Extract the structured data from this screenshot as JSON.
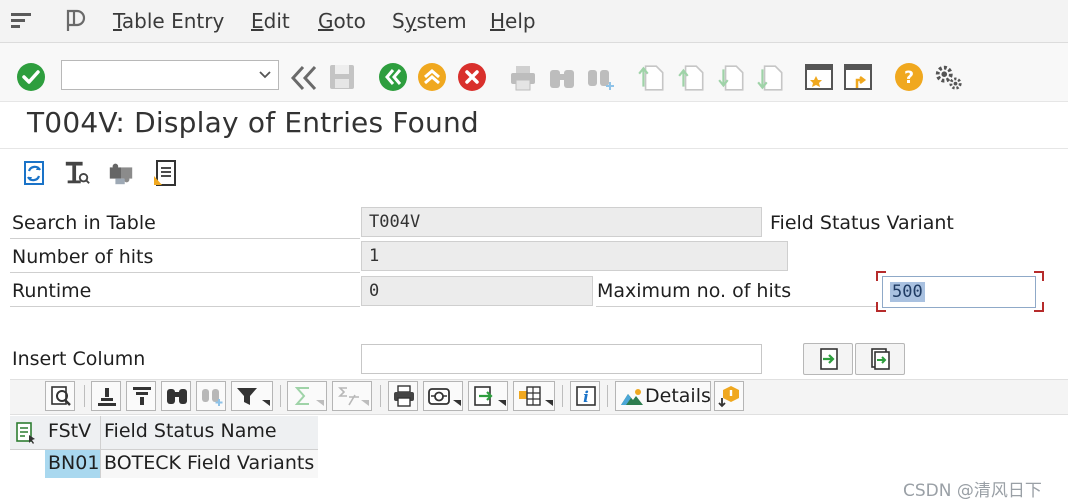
{
  "menu": {
    "items": [
      "Table Entry",
      "Edit",
      "Goto",
      "System",
      "Help"
    ],
    "underline": [
      "T",
      "E",
      "G",
      "y",
      "H"
    ]
  },
  "command_field": {
    "value": "",
    "placeholder": ""
  },
  "page": {
    "title": "T004V: Display of Entries Found"
  },
  "form": {
    "search_label": "Search in Table",
    "search_value": "T004V",
    "search_desc": "Field Status Variant",
    "hits_label": "Number of hits",
    "hits_value": "1",
    "runtime_label": "Runtime",
    "runtime_value": "0",
    "max_label": "Maximum no. of hits",
    "max_value": "500",
    "insert_label": "Insert Column",
    "insert_value": ""
  },
  "alv": {
    "details_label": "Details"
  },
  "grid": {
    "columns": [
      "FStV",
      "Field Status Name"
    ],
    "rows": [
      {
        "code": "BN01",
        "name": "BOTECK Field Variants"
      }
    ]
  },
  "watermark": "CSDN @清风日下",
  "colors": {
    "green": "#2e9e3e",
    "yellow": "#f0a81f",
    "red": "#d9302c",
    "selection": "#a9d8ef",
    "accent_blue": "#1a73c8"
  },
  "icons": [
    "menu-icon",
    "layout-icon",
    "check-icon",
    "back-icon",
    "save-icon",
    "exit-icon",
    "up-icon",
    "cancel-icon",
    "print-icon",
    "find-icon",
    "find-next-icon",
    "first-page-icon",
    "prev-page-icon",
    "next-page-icon",
    "last-page-icon",
    "new-session-icon",
    "shortcut-icon",
    "help-icon",
    "settings-icon"
  ]
}
